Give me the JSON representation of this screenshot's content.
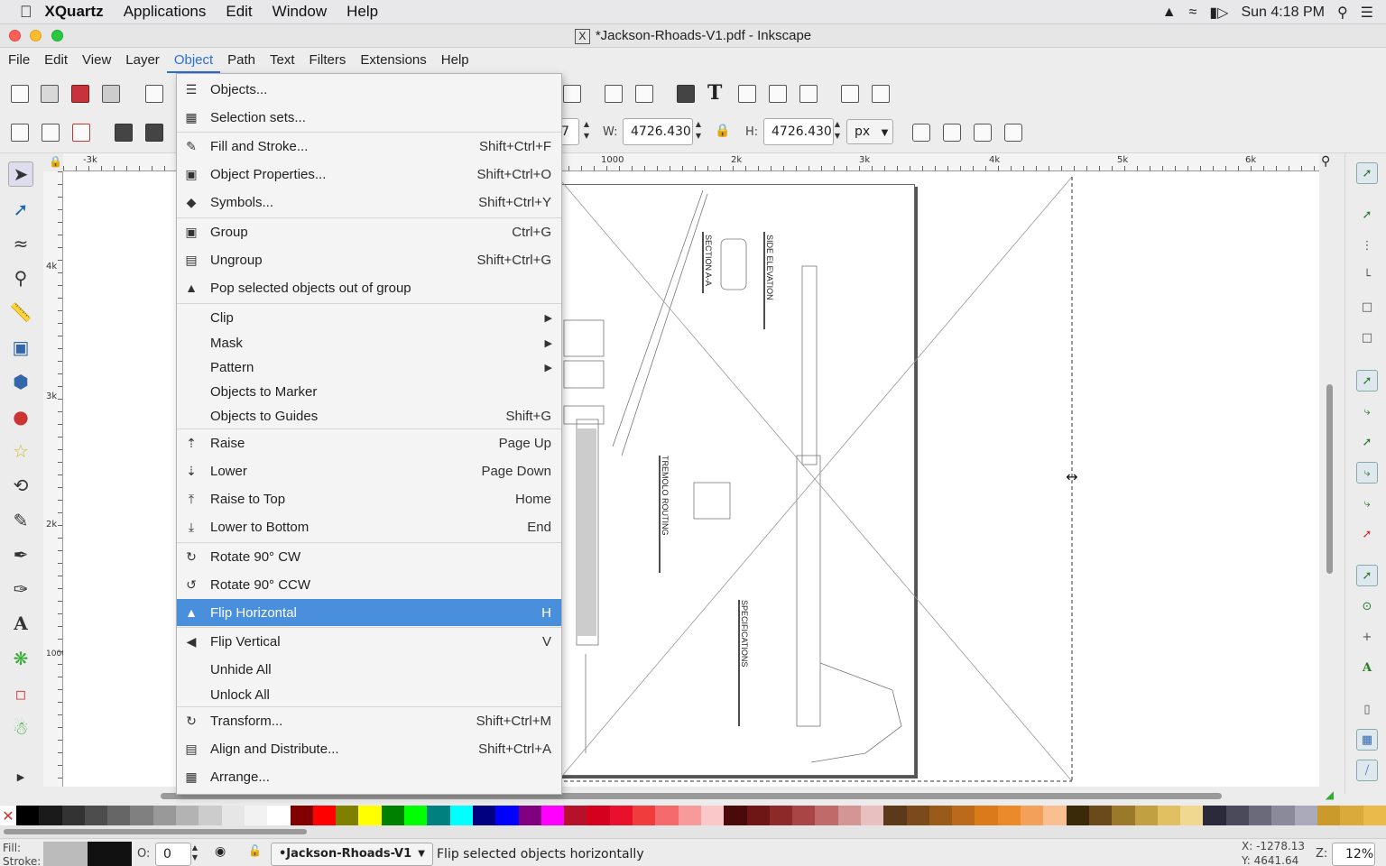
{
  "macos": {
    "apple": "",
    "menus": [
      "XQuartz",
      "Applications",
      "Edit",
      "Window",
      "Help"
    ],
    "clock": "Sun 4:18 PM"
  },
  "window": {
    "title": "*Jackson-Rhoads-V1.pdf - Inkscape"
  },
  "app_menu": [
    "File",
    "Edit",
    "View",
    "Layer",
    "Object",
    "Path",
    "Text",
    "Filters",
    "Extensions",
    "Help"
  ],
  "app_menu_active": "Object",
  "toolbar": {
    "y_spin_tail": "7",
    "w_label": "W:",
    "w_value": "4726.430",
    "h_label": "H:",
    "h_value": "4726.430",
    "unit": "px"
  },
  "rulers": {
    "h_ticks": [
      "-3k",
      "1000",
      "2k",
      "3k",
      "4k",
      "5k",
      "6k"
    ],
    "v_ticks": [
      "4k",
      "3k",
      "2k",
      "1000"
    ]
  },
  "drawing_labels": {
    "section": "SECTION A-A",
    "side_elevation": "SIDE ELEVATION",
    "tremolo": "TREMOLO ROUTING",
    "specifications": "SPECIFICATIONS"
  },
  "object_menu": {
    "items": [
      {
        "label": "Objects...",
        "shortcut": "",
        "icon": "objects-icon"
      },
      {
        "label": "Selection sets...",
        "shortcut": "",
        "icon": "selection-sets-icon"
      },
      {
        "label": "Fill and Stroke...",
        "shortcut": "Shift+Ctrl+F",
        "icon": "fill-stroke-icon"
      },
      {
        "label": "Object Properties...",
        "shortcut": "Shift+Ctrl+O",
        "icon": "object-properties-icon"
      },
      {
        "label": "Symbols...",
        "shortcut": "Shift+Ctrl+Y",
        "icon": "symbols-icon"
      },
      {
        "label": "Group",
        "shortcut": "Ctrl+G",
        "icon": "group-icon"
      },
      {
        "label": "Ungroup",
        "shortcut": "Shift+Ctrl+G",
        "icon": "ungroup-icon"
      },
      {
        "label": "Pop selected objects out of group",
        "shortcut": "",
        "icon": "pop-out-icon"
      },
      {
        "label": "Clip",
        "shortcut": "",
        "submenu": true
      },
      {
        "label": "Mask",
        "shortcut": "",
        "submenu": true
      },
      {
        "label": "Pattern",
        "shortcut": "",
        "submenu": true
      },
      {
        "label": "Objects to Marker",
        "shortcut": ""
      },
      {
        "label": "Objects to Guides",
        "shortcut": "Shift+G"
      },
      {
        "label": "Raise",
        "shortcut": "Page Up",
        "icon": "raise-icon"
      },
      {
        "label": "Lower",
        "shortcut": "Page Down",
        "icon": "lower-icon"
      },
      {
        "label": "Raise to Top",
        "shortcut": "Home",
        "icon": "raise-to-top-icon"
      },
      {
        "label": "Lower to Bottom",
        "shortcut": "End",
        "icon": "lower-to-bottom-icon"
      },
      {
        "label": "Rotate 90° CW",
        "shortcut": "",
        "icon": "rotate-cw-icon"
      },
      {
        "label": "Rotate 90° CCW",
        "shortcut": "",
        "icon": "rotate-ccw-icon"
      },
      {
        "label": "Flip Horizontal",
        "shortcut": "H",
        "icon": "flip-horizontal-icon",
        "highlighted": true
      },
      {
        "label": "Flip Vertical",
        "shortcut": "V",
        "icon": "flip-vertical-icon"
      },
      {
        "label": "Unhide All",
        "shortcut": ""
      },
      {
        "label": "Unlock All",
        "shortcut": ""
      },
      {
        "label": "Transform...",
        "shortcut": "Shift+Ctrl+M",
        "icon": "transform-icon"
      },
      {
        "label": "Align and Distribute...",
        "shortcut": "Shift+Ctrl+A",
        "icon": "align-distribute-icon"
      },
      {
        "label": "Arrange...",
        "shortcut": "",
        "icon": "arrange-icon"
      }
    ]
  },
  "status": {
    "fill_label": "Fill:",
    "stroke_label": "Stroke:",
    "opacity_label": "O:",
    "opacity_value": "0",
    "layer": "•Jackson-Rhoads-V1",
    "message": "Flip selected objects horizontally",
    "x_coord": "X: -1278.13",
    "y_coord": "Y: 4641.64",
    "zoom_label": "Z:",
    "zoom_value": "12%"
  },
  "colors": {
    "highlight": "#4a8fdc",
    "menu_bg": "#f4f4f4",
    "palette": [
      "#000000",
      "#1a1a1a",
      "#333333",
      "#4d4d4d",
      "#666666",
      "#808080",
      "#999999",
      "#b3b3b3",
      "#cccccc",
      "#e6e6e6",
      "#f2f2f2",
      "#ffffff",
      "#800000",
      "#ff0000",
      "#808000",
      "#ffff00",
      "#008000",
      "#00ff00",
      "#008080",
      "#00ffff",
      "#000080",
      "#0000ff",
      "#800080",
      "#ff00ff",
      "#b5112b",
      "#d4001c",
      "#e8102a",
      "#f03c3c",
      "#f56a6a",
      "#f89a9a",
      "#fac8c8",
      "#4a0a0a",
      "#6e1515",
      "#8c2a2a",
      "#a84545",
      "#c06a6a",
      "#d49595",
      "#e8c0c0",
      "#5a3a1a",
      "#7a4a1a",
      "#9a5a1a",
      "#ba6a1a",
      "#da7a1a",
      "#ea8a2a",
      "#f2a05a",
      "#f8c090",
      "#3a2a0a",
      "#6a4a1a",
      "#9a7a2a",
      "#c0a040",
      "#e0c060",
      "#f0d890",
      "#2a2a3a",
      "#4a4a5a",
      "#6a6a7a",
      "#8a8a9a",
      "#aaaaba",
      "#ca9a2a",
      "#daaa3a",
      "#eaba4a"
    ]
  }
}
